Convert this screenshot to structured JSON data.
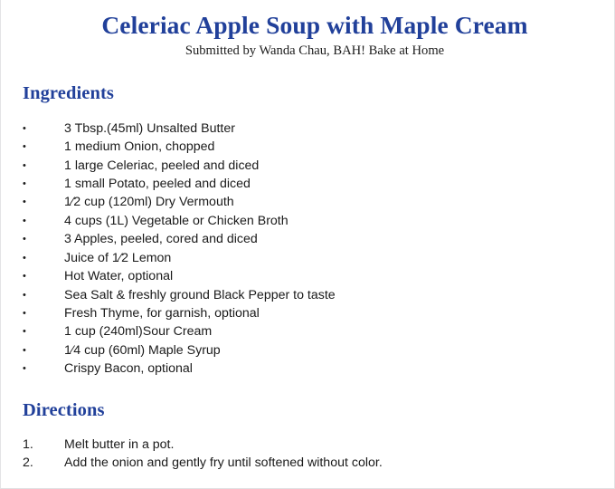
{
  "document": {
    "title": "Celeriac Apple Soup with Maple Cream",
    "subtitle": "Submitted by Wanda Chau, BAH! Bake at Home",
    "accent_color": "#21409a",
    "body_color": "#1a1a1a",
    "background_color": "#ffffff"
  },
  "ingredients": {
    "heading": "Ingredients",
    "bullet_glyph": "•",
    "items": [
      {
        "marker": "•",
        "text": "3 Tbsp.(45ml) Unsalted Butter"
      },
      {
        "marker": "•",
        "text": "1 medium Onion, chopped"
      },
      {
        "marker": "•",
        "text": "1 large Celeriac, peeled and diced"
      },
      {
        "marker": "•",
        "text": "1 small Potato, peeled and diced"
      },
      {
        "marker": "•",
        "text": "1⁄2 cup (120ml) Dry Vermouth"
      },
      {
        "marker": "•",
        "text": "4 cups (1L) Vegetable or Chicken Broth"
      },
      {
        "marker": "•",
        "text": "3 Apples, peeled, cored and diced"
      },
      {
        "marker": "•",
        "text": "Juice of 1⁄2 Lemon"
      },
      {
        "marker": "•",
        "text": "Hot Water, optional"
      },
      {
        "marker": "•",
        "text": "Sea Salt & freshly ground Black Pepper to taste"
      },
      {
        "marker": "•",
        "text": "Fresh Thyme, for garnish, optional"
      },
      {
        "marker": "•",
        "text": "1 cup (240ml)Sour Cream"
      },
      {
        "marker": "•",
        "text": "1⁄4 cup (60ml) Maple Syrup"
      },
      {
        "marker": "•",
        "text": "Crispy Bacon, optional"
      }
    ]
  },
  "directions": {
    "heading": "Directions",
    "items": [
      {
        "marker": "1.",
        "text": "Melt butter in a pot."
      },
      {
        "marker": "2.",
        "text": "Add the onion and gently fry until softened without color."
      }
    ]
  }
}
